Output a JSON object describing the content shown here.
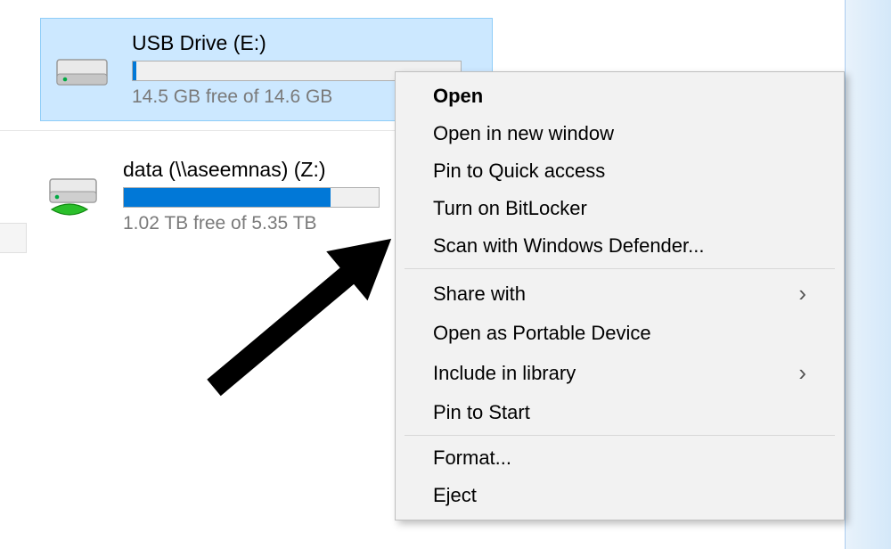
{
  "drives": {
    "usb": {
      "name": "USB Drive (E:)",
      "free_text": "14.5 GB free of 14.6 GB",
      "fill_percent": 1
    },
    "network": {
      "name": "data (\\\\aseemnas) (Z:)",
      "free_text": "1.02 TB free of 5.35 TB",
      "fill_percent": 81
    }
  },
  "context_menu": {
    "open": "Open",
    "open_new_window": "Open in new window",
    "pin_quick_access": "Pin to Quick access",
    "bitlocker": "Turn on BitLocker",
    "scan_defender": "Scan with Windows Defender...",
    "share_with": "Share with",
    "open_portable": "Open as Portable Device",
    "include_library": "Include in library",
    "pin_start": "Pin to Start",
    "format": "Format...",
    "eject": "Eject"
  },
  "glyphs": {
    "chevron": "›"
  }
}
